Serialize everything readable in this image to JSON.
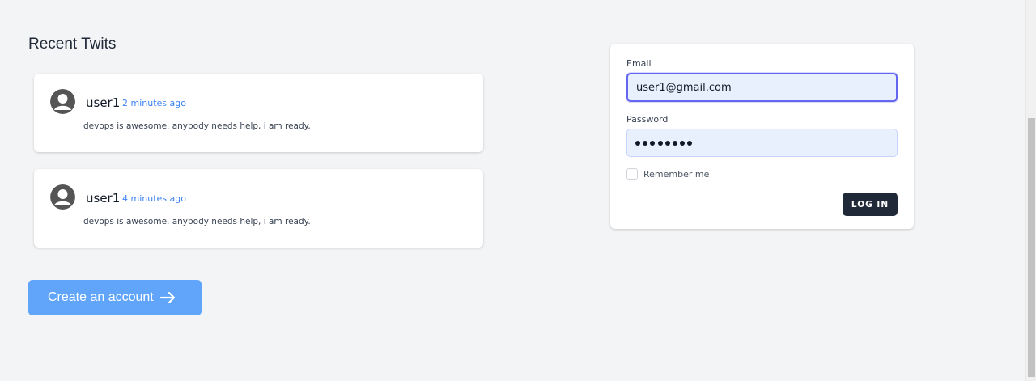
{
  "recent": {
    "title": "Recent Twits",
    "twits": [
      {
        "user": "user1",
        "time": "2 minutes ago",
        "text": "devops is awesome. anybody needs help, i am ready.",
        "avatar_icon": "user-avatar-icon"
      },
      {
        "user": "user1",
        "time": "4 minutes ago",
        "text": "devops is awesome. anybody needs help, i am ready.",
        "avatar_icon": "user-avatar-icon"
      }
    ],
    "create_account_label": "Create an account",
    "create_account_icon": "arrow-right-icon"
  },
  "login": {
    "email_label": "Email",
    "email_value": "user1@gmail.com",
    "password_label": "Password",
    "password_length": 8,
    "remember_label": "Remember me",
    "remember_checked": false,
    "submit_label": "LOG IN"
  },
  "colors": {
    "page_bg": "#f3f4f6",
    "accent_link": "#3b82f6",
    "create_button": "#60a5fa",
    "login_button": "#1f2937",
    "input_fill": "#e8f0fe",
    "focus_ring": "#6366f1"
  }
}
